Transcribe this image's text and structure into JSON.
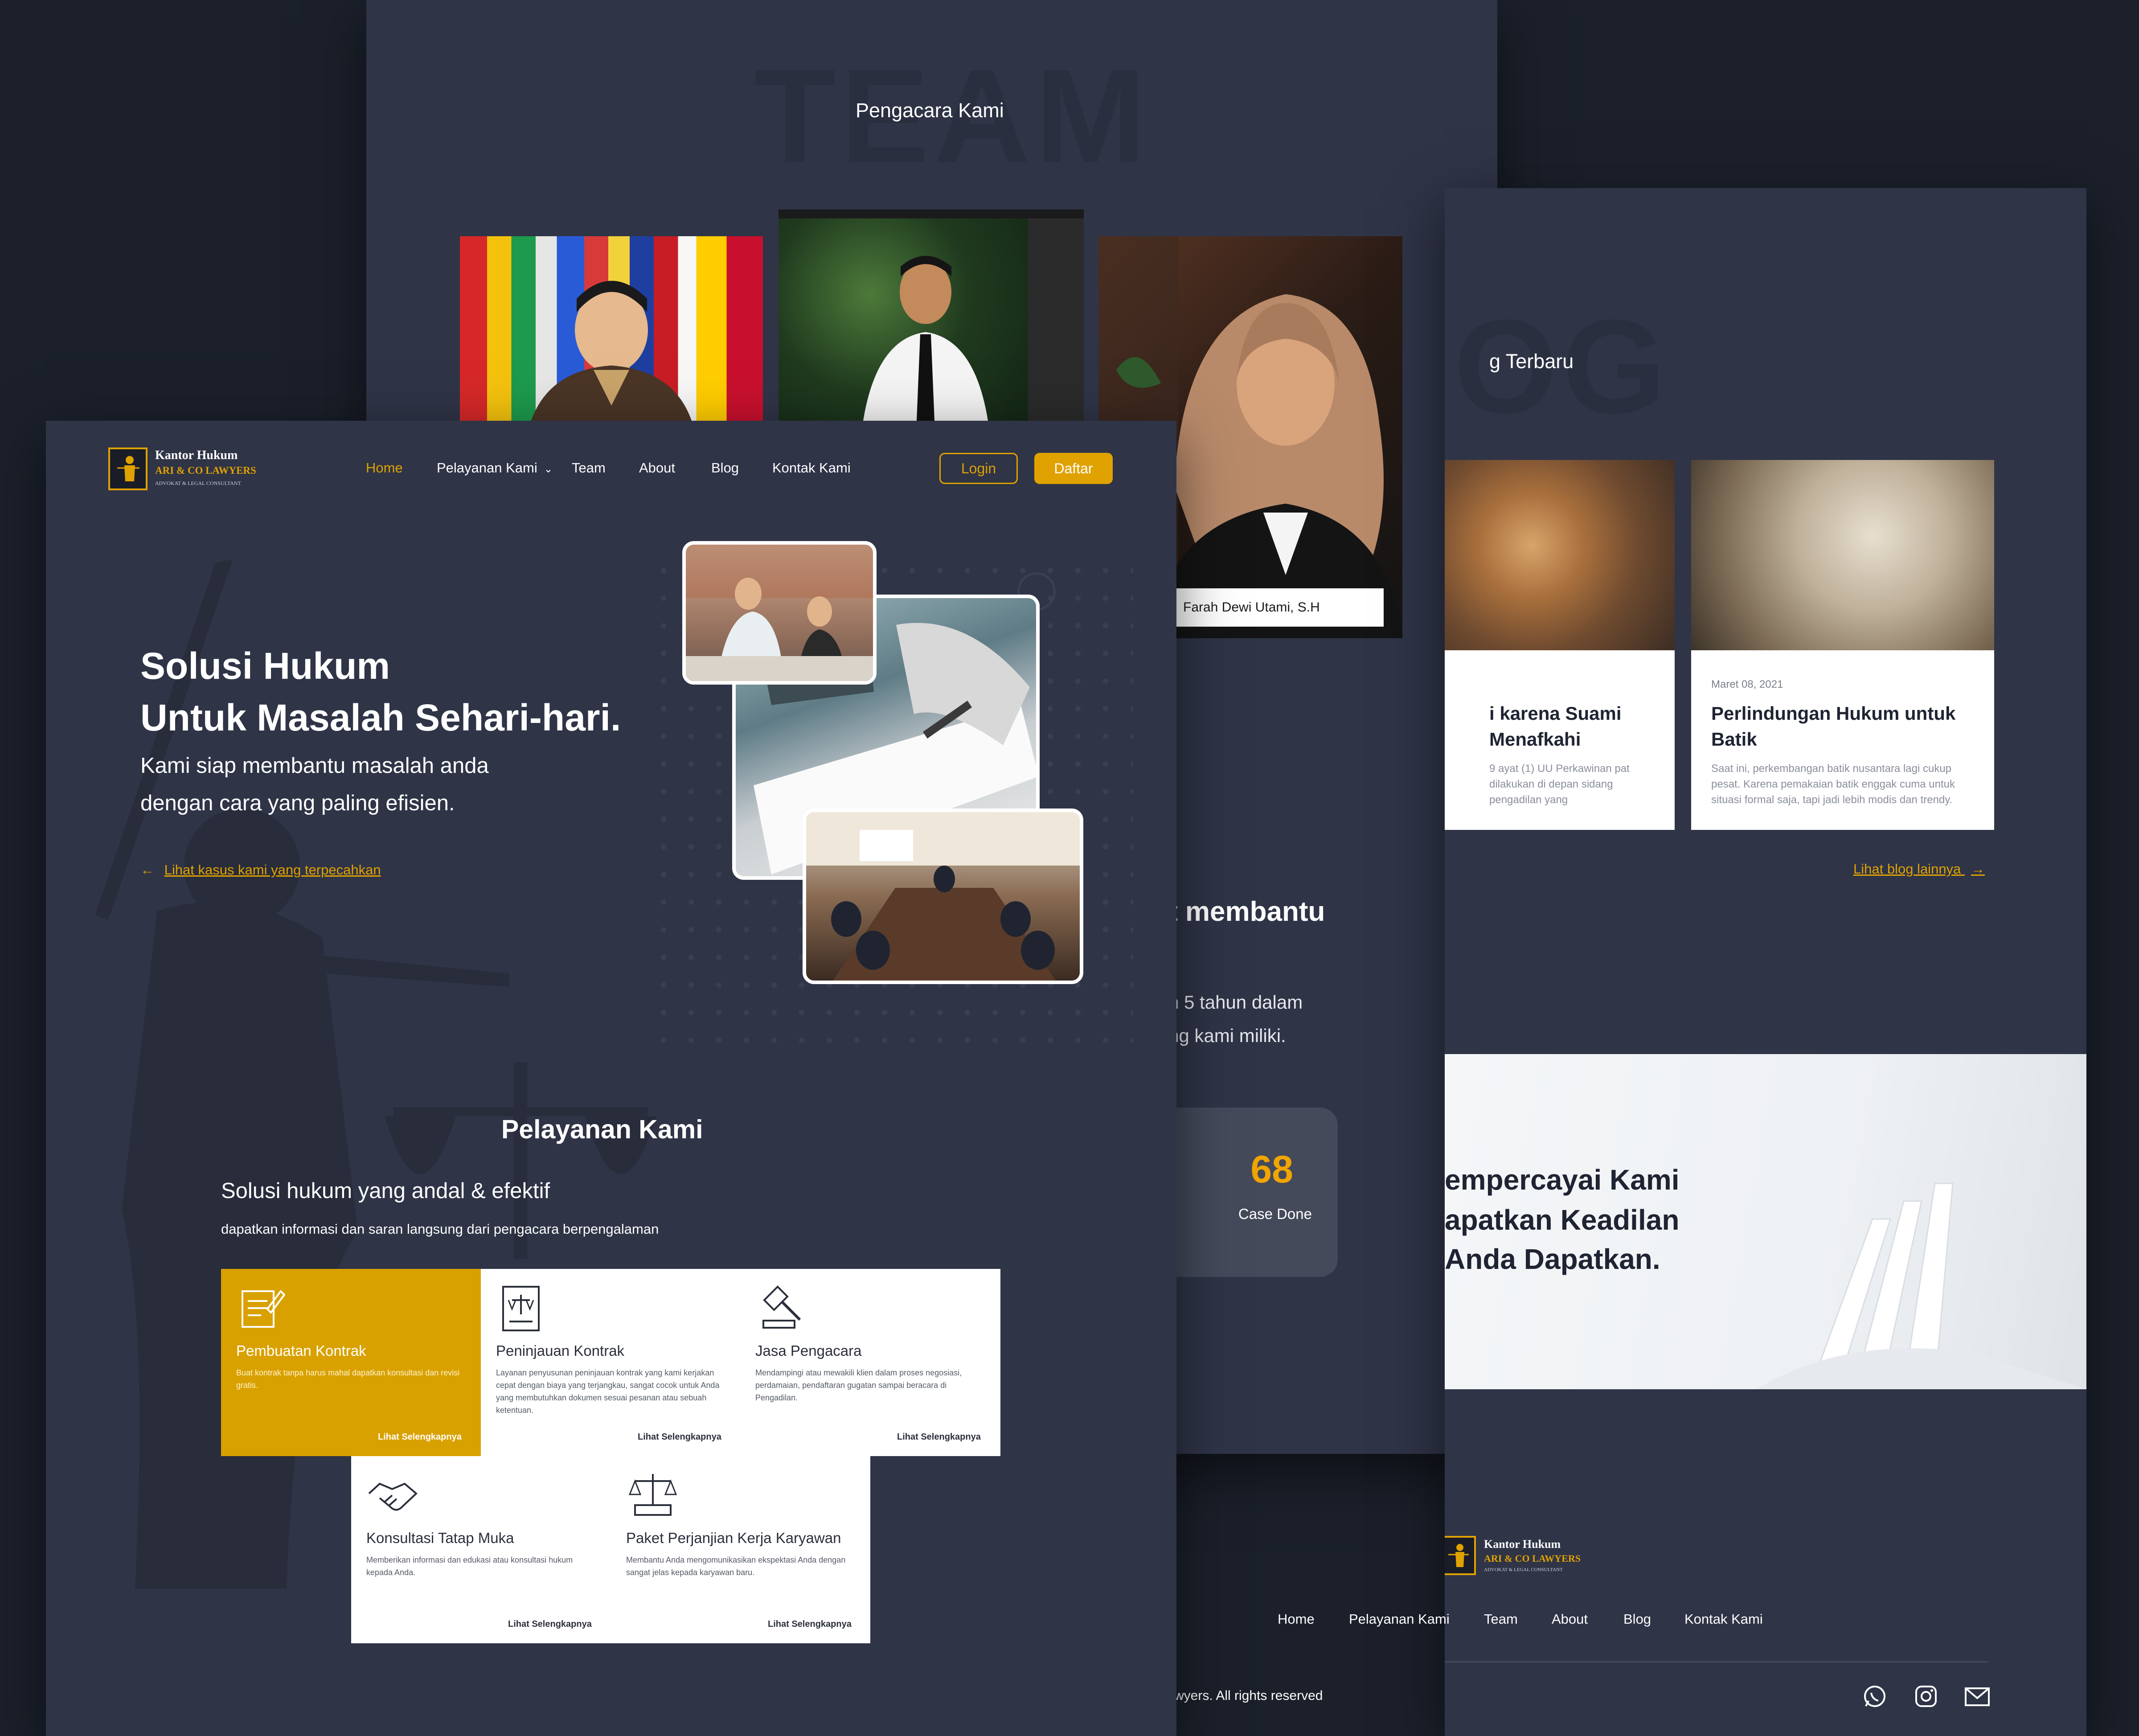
{
  "brand": {
    "name_line1": "Kantor Hukum",
    "name_line2": "ARI & CO LAWYERS",
    "tagline": "ADVOKAT & LEGAL CONSULTANT",
    "accent": "#e0a200"
  },
  "team": {
    "bg_word": "TEAM",
    "title": "Pengacara Kami",
    "members": [
      {
        "name": ""
      },
      {
        "name": ""
      },
      {
        "name": "Farah Dewi Utami, S.H"
      }
    ]
  },
  "blog": {
    "bg_word": "OG",
    "title_partial": "g Terbaru",
    "posts": [
      {
        "title_line1": "i karena Suami",
        "title_line2": "Menafkahi",
        "excerpt": "9 ayat (1) UU Perkawinan pat dilakukan di depan sidang pengadilan yang"
      },
      {
        "date": "Maret 08, 2021",
        "title_line1": "Perlindungan Hukum untuk",
        "title_line2": "Batik",
        "excerpt": "Saat ini, perkembangan batik nusantara lagi cukup pesat. Karena pemakaian batik enggak cuma untuk situasi formal saja, tapi jadi lebih modis dan trendy."
      }
    ],
    "more_link": "Lihat blog lainnya"
  },
  "about": {
    "heading_partial": "t membantu",
    "line1": "n 5 tahun dalam",
    "line2": "ng kami miliki.",
    "stat_value": "68",
    "stat_label": "Case Done"
  },
  "cta": {
    "line1": "empercayai Kami",
    "line2": "apatkan Keadilan",
    "line3": "Anda Dapatkan."
  },
  "nav": {
    "items": [
      {
        "label": "Home",
        "active": true
      },
      {
        "label": "Pelayanan Kami"
      },
      {
        "label": "Team"
      },
      {
        "label": "About"
      },
      {
        "label": "Blog"
      },
      {
        "label": "Kontak Kami"
      }
    ],
    "login": "Login",
    "register": "Daftar"
  },
  "hero": {
    "title_line1": "Solusi Hukum",
    "title_line2": "Untuk Masalah Sehari-hari.",
    "subtitle_line1": "Kami siap membantu masalah anda",
    "subtitle_line2": "dengan cara yang paling efisien.",
    "link": "Lihat kasus kami yang terpecahkan"
  },
  "services": {
    "title": "Pelayanan Kami",
    "subtitle": "Solusi hukum yang andal & efektif",
    "description": "dapatkan informasi dan saran langsung dari pengacara berpengalaman",
    "more_label": "Lihat Selengkapnya",
    "items": [
      {
        "icon": "contract-icon",
        "title": "Pembuatan Kontrak",
        "text": "Buat kontrak tanpa harus mahal dapatkan konsultasi dan revisi gratis.",
        "highlighted": true
      },
      {
        "icon": "law-book-icon",
        "title": "Peninjauan Kontrak",
        "text": "Layanan penyusunan peninjauan kontrak yang kami kerjakan cepat dengan biaya yang terjangkau, sangat cocok untuk Anda yang membutuhkan dokumen sesuai pesanan atau sebuah ketentuan."
      },
      {
        "icon": "gavel-icon",
        "title": "Jasa Pengacara",
        "text": "Mendampingi atau mewakili klien dalam proses negosiasi, perdamaian, pendaftaran gugatan sampai beracara di Pengadilan."
      },
      {
        "icon": "handshake-icon",
        "title": "Konsultasi Tatap Muka",
        "text": "Memberikan informasi dan edukasi atau konsultasi hukum kepada Anda."
      },
      {
        "icon": "scales-icon",
        "title": "Paket Perjanjian Kerja Karyawan",
        "text": "Membantu Anda mengomunikasikan ekspektasi Anda dengan sangat jelas kepada karyawan baru."
      }
    ]
  },
  "footer": {
    "links": [
      "Home",
      "Pelayanan Kami",
      "Team",
      "About",
      "Blog",
      "Kontak Kami"
    ],
    "copyright": "wyers. All rights reserved",
    "social": [
      "whatsapp-icon",
      "instagram-icon",
      "mail-icon"
    ]
  }
}
